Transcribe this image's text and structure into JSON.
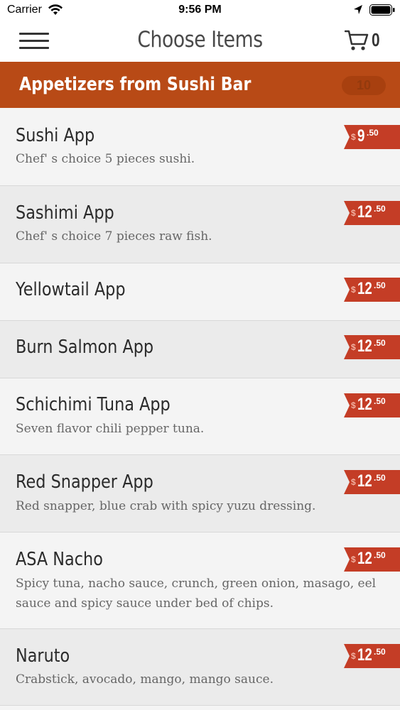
{
  "status_bar": {
    "carrier": "Carrier",
    "time": "9:56 PM",
    "icons": [
      "wifi-icon",
      "location-icon",
      "battery-icon"
    ]
  },
  "nav": {
    "title": "Choose Items",
    "cart_count": "0",
    "icons": [
      "menu-icon",
      "cart-icon"
    ]
  },
  "section": {
    "title": "Appetizers from Sushi Bar",
    "badge": "10"
  },
  "items": [
    {
      "name": "Sushi App",
      "description": "Chef' s choice 5 pieces sushi.",
      "price_dollars": "9",
      "price_cents": ".50"
    },
    {
      "name": "Sashimi App",
      "description": "Chef' s choice 7 pieces raw fish.",
      "price_dollars": "12",
      "price_cents": ".50"
    },
    {
      "name": "Yellowtail App",
      "description": "",
      "price_dollars": "12",
      "price_cents": ".50"
    },
    {
      "name": "Burn Salmon App",
      "description": "",
      "price_dollars": "12",
      "price_cents": ".50"
    },
    {
      "name": "Schichimi Tuna App",
      "description": "Seven flavor chili pepper tuna.",
      "price_dollars": "12",
      "price_cents": ".50"
    },
    {
      "name": "Red Snapper App",
      "description": "Red snapper, blue crab with spicy yuzu dressing.",
      "price_dollars": "12",
      "price_cents": ".50"
    },
    {
      "name": "ASA Nacho",
      "description": "Spicy tuna, nacho sauce, crunch, green onion, masago, eel sauce and spicy sauce under bed of chips.",
      "price_dollars": "12",
      "price_cents": ".50"
    },
    {
      "name": "Naruto",
      "description": "Crabstick, avocado, mango, mango sauce.",
      "price_dollars": "12",
      "price_cents": ".50"
    }
  ],
  "price_currency": "$",
  "colors": {
    "accent": "#b84a16",
    "price_tag": "#c43d26",
    "text": "#2b2b2b"
  }
}
